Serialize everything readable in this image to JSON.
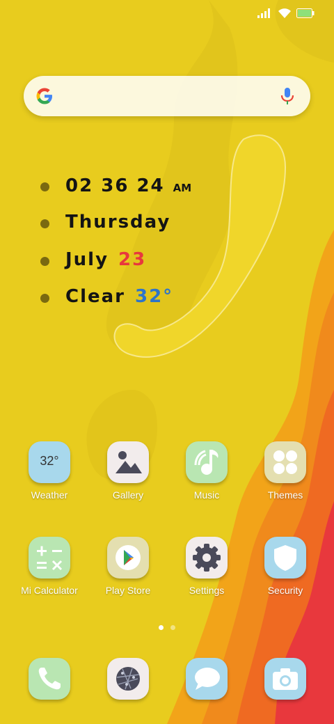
{
  "status_bar": {
    "icons": [
      "signal-icon",
      "wifi-icon",
      "battery-icon"
    ]
  },
  "search": {
    "logo": "google-logo",
    "mic": "mic-icon"
  },
  "widget": {
    "time": "02 36 24",
    "ampm": "AM",
    "weekday": "Thursday",
    "month": "July",
    "day": "23",
    "condition": "Clear",
    "temperature": "32°"
  },
  "apps": [
    {
      "label": "Weather",
      "icon": "weather-icon",
      "badge": "32°"
    },
    {
      "label": "Gallery",
      "icon": "gallery-icon"
    },
    {
      "label": "Music",
      "icon": "music-icon"
    },
    {
      "label": "Themes",
      "icon": "themes-icon"
    },
    {
      "label": "Mi Calculator",
      "icon": "calculator-icon"
    },
    {
      "label": "Play Store",
      "icon": "play-store-icon"
    },
    {
      "label": "Settings",
      "icon": "gear-icon"
    },
    {
      "label": "Security",
      "icon": "shield-icon"
    }
  ],
  "dock": [
    {
      "icon": "phone-icon"
    },
    {
      "icon": "browser-icon"
    },
    {
      "icon": "messages-icon"
    },
    {
      "icon": "camera-icon"
    }
  ],
  "pager": {
    "pages": 2,
    "active": 1
  },
  "colors": {
    "wallpaper_yellow": "#e8cc1e",
    "wallpaper_orange": "#f08a1c",
    "wallpaper_red": "#e8383d",
    "accent_red": "#e8383d",
    "accent_blue": "#2d74c9"
  }
}
